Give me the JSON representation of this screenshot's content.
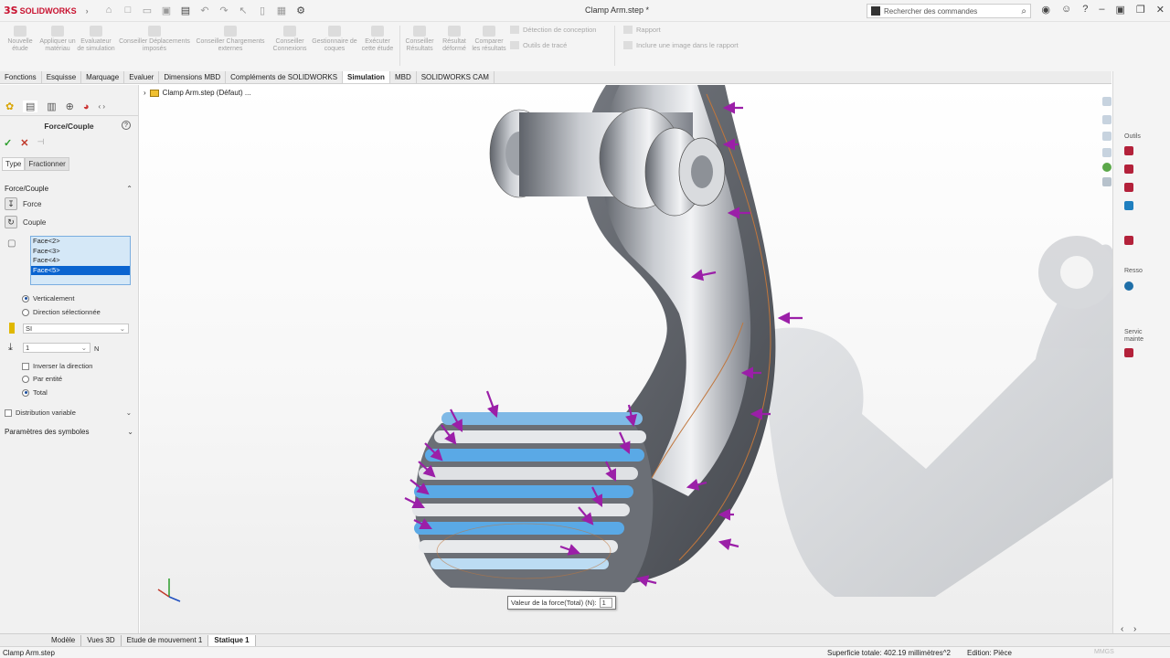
{
  "app": {
    "brand": "SOLIDWORKS",
    "title": "Clamp Arm.step *",
    "search_placeholder": "Rechercher des commandes"
  },
  "commands": [
    {
      "label": "Nouvelle étude"
    },
    {
      "label": "Appliquer un matériau"
    },
    {
      "label": "Evaluateur de simulation"
    },
    {
      "label": "Conseiller Déplacements imposés"
    },
    {
      "label": "Conseiller Chargements externes"
    },
    {
      "label": "Conseiller Connexions"
    },
    {
      "label": "Gestionnaire de coques"
    },
    {
      "label": "Exécuter cette étude"
    },
    {
      "label": "Conseiller Résultats"
    },
    {
      "label": "Résultat déformé"
    },
    {
      "label": "Comparer les résultats"
    }
  ],
  "commands_small": {
    "design_insight": "Détection de conception",
    "trace_tools": "Outils de tracé",
    "report": "Rapport",
    "include_image": "Inclure une image dans le rapport"
  },
  "tabs": [
    "Fonctions",
    "Esquisse",
    "Marquage",
    "Evaluer",
    "Dimensions MBD",
    "Compléments de SOLIDWORKS",
    "Simulation",
    "MBD",
    "SOLIDWORKS CAM"
  ],
  "active_tab": "Simulation",
  "property_manager": {
    "title": "Force/Couple",
    "subtabs": [
      "Type",
      "Fractionner"
    ],
    "group_title": "Force/Couple",
    "force_label": "Force",
    "torque_label": "Couple",
    "faces": [
      "Face<2>",
      "Face<3>",
      "Face<4>",
      "Face<5>"
    ],
    "selected_face": "Face<5>",
    "direction_options": [
      "Verticalement",
      "Direction sélectionnée"
    ],
    "direction_selected": "Verticalement",
    "unit_system": "SI",
    "force_value": "1",
    "force_unit": "N",
    "invert_label": "Inverser la direction",
    "distribution_options": [
      "Par entité",
      "Total"
    ],
    "distribution_selected": "Total",
    "variable_distribution": "Distribution variable",
    "symbol_params": "Paramètres des symboles"
  },
  "tree": {
    "root": "Clamp Arm.step (Défaut) ..."
  },
  "viewport": {
    "tooltip_label": "Valeur de la force(Total) (N):",
    "tooltip_value": "1"
  },
  "task_pane": {
    "tools_label": "Outils",
    "resources_label": "Resso",
    "services_label": "Servic mainte"
  },
  "bottom_tabs": [
    "Modèle",
    "Vues 3D",
    "Etude de mouvement 1",
    "Statique 1"
  ],
  "active_bottom_tab": "Statique 1",
  "status": {
    "file": "Clamp Arm.step",
    "area": "Superficie totale: 402.19 millimètres^2",
    "edition": "Edition: Pièce",
    "mmgs": "MMGS"
  },
  "colors": {
    "brand_red": "#c8102e",
    "selection_blue": "#0a64d0",
    "load_arrow": "#9b1fa8",
    "face_highlight": "#5aa9e6"
  }
}
